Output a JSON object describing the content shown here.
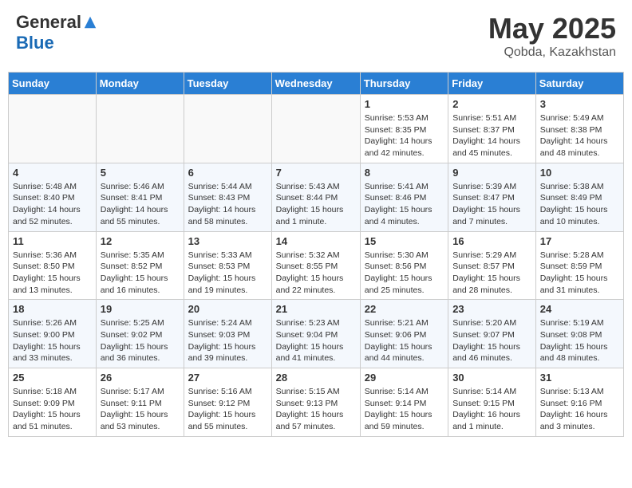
{
  "header": {
    "logo_general": "General",
    "logo_blue": "Blue",
    "month": "May 2025",
    "location": "Qobda, Kazakhstan"
  },
  "weekdays": [
    "Sunday",
    "Monday",
    "Tuesday",
    "Wednesday",
    "Thursday",
    "Friday",
    "Saturday"
  ],
  "weeks": [
    [
      {
        "day": "",
        "info": ""
      },
      {
        "day": "",
        "info": ""
      },
      {
        "day": "",
        "info": ""
      },
      {
        "day": "",
        "info": ""
      },
      {
        "day": "1",
        "info": "Sunrise: 5:53 AM\nSunset: 8:35 PM\nDaylight: 14 hours\nand 42 minutes."
      },
      {
        "day": "2",
        "info": "Sunrise: 5:51 AM\nSunset: 8:37 PM\nDaylight: 14 hours\nand 45 minutes."
      },
      {
        "day": "3",
        "info": "Sunrise: 5:49 AM\nSunset: 8:38 PM\nDaylight: 14 hours\nand 48 minutes."
      }
    ],
    [
      {
        "day": "4",
        "info": "Sunrise: 5:48 AM\nSunset: 8:40 PM\nDaylight: 14 hours\nand 52 minutes."
      },
      {
        "day": "5",
        "info": "Sunrise: 5:46 AM\nSunset: 8:41 PM\nDaylight: 14 hours\nand 55 minutes."
      },
      {
        "day": "6",
        "info": "Sunrise: 5:44 AM\nSunset: 8:43 PM\nDaylight: 14 hours\nand 58 minutes."
      },
      {
        "day": "7",
        "info": "Sunrise: 5:43 AM\nSunset: 8:44 PM\nDaylight: 15 hours\nand 1 minute."
      },
      {
        "day": "8",
        "info": "Sunrise: 5:41 AM\nSunset: 8:46 PM\nDaylight: 15 hours\nand 4 minutes."
      },
      {
        "day": "9",
        "info": "Sunrise: 5:39 AM\nSunset: 8:47 PM\nDaylight: 15 hours\nand 7 minutes."
      },
      {
        "day": "10",
        "info": "Sunrise: 5:38 AM\nSunset: 8:49 PM\nDaylight: 15 hours\nand 10 minutes."
      }
    ],
    [
      {
        "day": "11",
        "info": "Sunrise: 5:36 AM\nSunset: 8:50 PM\nDaylight: 15 hours\nand 13 minutes."
      },
      {
        "day": "12",
        "info": "Sunrise: 5:35 AM\nSunset: 8:52 PM\nDaylight: 15 hours\nand 16 minutes."
      },
      {
        "day": "13",
        "info": "Sunrise: 5:33 AM\nSunset: 8:53 PM\nDaylight: 15 hours\nand 19 minutes."
      },
      {
        "day": "14",
        "info": "Sunrise: 5:32 AM\nSunset: 8:55 PM\nDaylight: 15 hours\nand 22 minutes."
      },
      {
        "day": "15",
        "info": "Sunrise: 5:30 AM\nSunset: 8:56 PM\nDaylight: 15 hours\nand 25 minutes."
      },
      {
        "day": "16",
        "info": "Sunrise: 5:29 AM\nSunset: 8:57 PM\nDaylight: 15 hours\nand 28 minutes."
      },
      {
        "day": "17",
        "info": "Sunrise: 5:28 AM\nSunset: 8:59 PM\nDaylight: 15 hours\nand 31 minutes."
      }
    ],
    [
      {
        "day": "18",
        "info": "Sunrise: 5:26 AM\nSunset: 9:00 PM\nDaylight: 15 hours\nand 33 minutes."
      },
      {
        "day": "19",
        "info": "Sunrise: 5:25 AM\nSunset: 9:02 PM\nDaylight: 15 hours\nand 36 minutes."
      },
      {
        "day": "20",
        "info": "Sunrise: 5:24 AM\nSunset: 9:03 PM\nDaylight: 15 hours\nand 39 minutes."
      },
      {
        "day": "21",
        "info": "Sunrise: 5:23 AM\nSunset: 9:04 PM\nDaylight: 15 hours\nand 41 minutes."
      },
      {
        "day": "22",
        "info": "Sunrise: 5:21 AM\nSunset: 9:06 PM\nDaylight: 15 hours\nand 44 minutes."
      },
      {
        "day": "23",
        "info": "Sunrise: 5:20 AM\nSunset: 9:07 PM\nDaylight: 15 hours\nand 46 minutes."
      },
      {
        "day": "24",
        "info": "Sunrise: 5:19 AM\nSunset: 9:08 PM\nDaylight: 15 hours\nand 48 minutes."
      }
    ],
    [
      {
        "day": "25",
        "info": "Sunrise: 5:18 AM\nSunset: 9:09 PM\nDaylight: 15 hours\nand 51 minutes."
      },
      {
        "day": "26",
        "info": "Sunrise: 5:17 AM\nSunset: 9:11 PM\nDaylight: 15 hours\nand 53 minutes."
      },
      {
        "day": "27",
        "info": "Sunrise: 5:16 AM\nSunset: 9:12 PM\nDaylight: 15 hours\nand 55 minutes."
      },
      {
        "day": "28",
        "info": "Sunrise: 5:15 AM\nSunset: 9:13 PM\nDaylight: 15 hours\nand 57 minutes."
      },
      {
        "day": "29",
        "info": "Sunrise: 5:14 AM\nSunset: 9:14 PM\nDaylight: 15 hours\nand 59 minutes."
      },
      {
        "day": "30",
        "info": "Sunrise: 5:14 AM\nSunset: 9:15 PM\nDaylight: 16 hours\nand 1 minute."
      },
      {
        "day": "31",
        "info": "Sunrise: 5:13 AM\nSunset: 9:16 PM\nDaylight: 16 hours\nand 3 minutes."
      }
    ]
  ]
}
